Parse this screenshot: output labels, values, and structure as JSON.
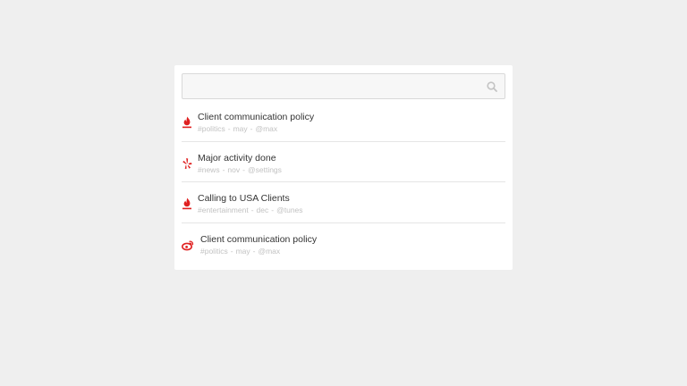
{
  "search": {
    "placeholder": "",
    "value": "",
    "icon": "search-icon"
  },
  "items": [
    {
      "icon": "fire-icon",
      "title": "Client communication policy",
      "tag": "#politics",
      "month": "may",
      "user": "@max"
    },
    {
      "icon": "yelp-icon",
      "title": "Major activity done",
      "tag": "#news",
      "month": "nov",
      "user": "@settings"
    },
    {
      "icon": "fire-icon",
      "title": "Calling to USA Clients",
      "tag": "#entertainment",
      "month": "dec",
      "user": "@tunes"
    },
    {
      "icon": "weibo-icon",
      "title": "Client communication policy",
      "tag": "#politics",
      "month": "may",
      "user": "@max"
    }
  ],
  "separator": "-",
  "colors": {
    "accent": "#e02020",
    "background": "#efefef",
    "card": "#ffffff"
  }
}
